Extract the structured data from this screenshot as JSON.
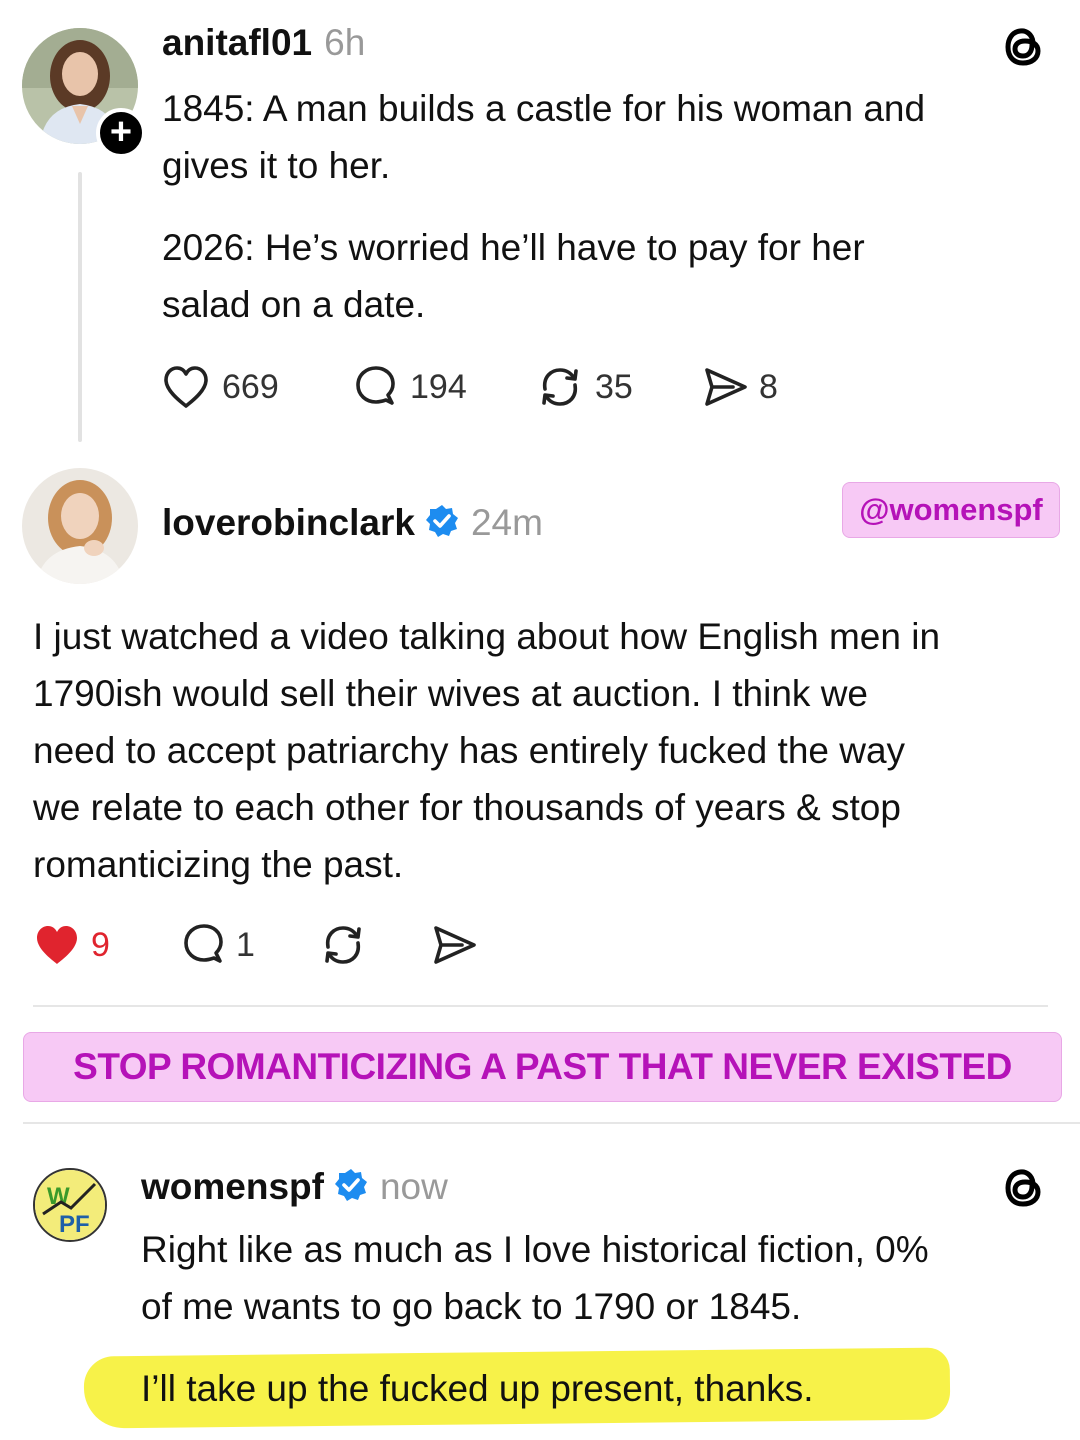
{
  "post1": {
    "username": "anitafl01",
    "time": "6h",
    "paragraph1_line1": "1845: A man builds a castle for his woman and",
    "paragraph1_line2": "gives it to her.",
    "paragraph2_line1": "2026: He’s worried he’ll have to pay for her",
    "paragraph2_line2": "salad on a date.",
    "likes": "669",
    "replies": "194",
    "reposts": "35",
    "shares": "8",
    "follow_icon": "plus-icon",
    "app_icon": "threads-icon"
  },
  "post2": {
    "username": "loverobinclark",
    "time": "24m",
    "tag": "@womenspf",
    "lines": [
      "I just watched a video talking about how English men in",
      "1790ish would sell their wives at auction. I think we",
      "need to accept patriarchy has entirely fucked the way",
      "we relate to each other for thousands of years & stop",
      "romanticizing the past."
    ],
    "likes": "9",
    "replies": "1",
    "like_color": "#e0242e"
  },
  "banner": {
    "text": "STOP ROMANTICIZING A PAST THAT NEVER EXISTED",
    "bg_color": "#f7c9f5",
    "text_color": "#b512b8"
  },
  "post3": {
    "username": "womenspf",
    "time": "now",
    "line1": "Right like as much as I love historical fiction, 0%",
    "line2": "of me wants to go back to 1790 or 1845.",
    "highlight_line": "I’ll take up the fucked up present, thanks.",
    "highlight_color": "#f6f13a",
    "avatar_text": "WPF"
  }
}
